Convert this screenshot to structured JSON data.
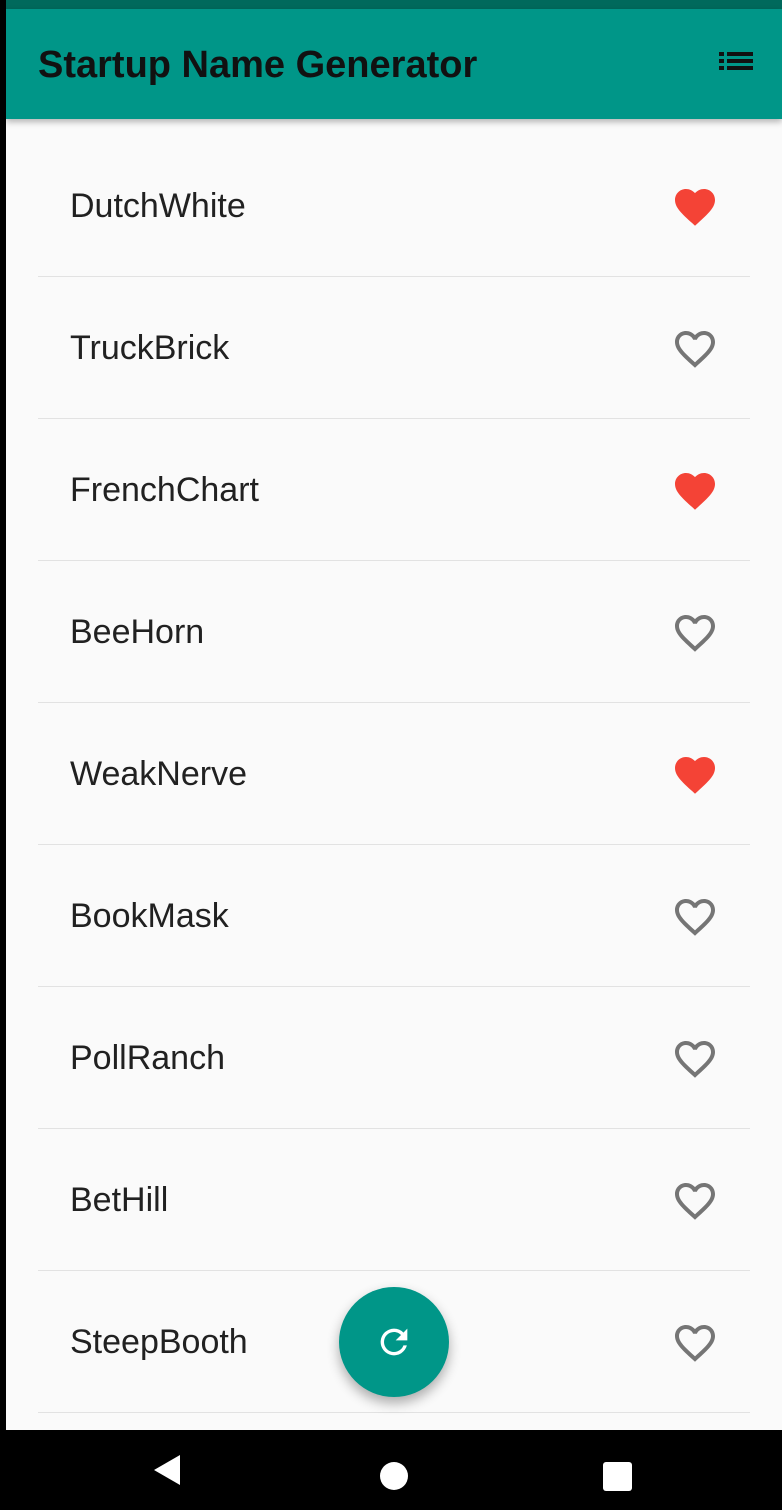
{
  "app_bar": {
    "title": "Startup Name Generator",
    "list_icon": "list-icon"
  },
  "rows": [
    {
      "label": "DutchWhite",
      "favorite": true
    },
    {
      "label": "TruckBrick",
      "favorite": false
    },
    {
      "label": "FrenchChart",
      "favorite": true
    },
    {
      "label": "BeeHorn",
      "favorite": false
    },
    {
      "label": "WeakNerve",
      "favorite": true
    },
    {
      "label": "BookMask",
      "favorite": false
    },
    {
      "label": "PollRanch",
      "favorite": false
    },
    {
      "label": "BetHill",
      "favorite": false
    },
    {
      "label": "SteepBooth",
      "favorite": false
    }
  ],
  "fab": {
    "icon": "refresh-icon"
  },
  "nav_bar": {
    "back_icon": "back-icon",
    "home_icon": "home-icon",
    "recents_icon": "recents-icon"
  },
  "colors": {
    "primary": "#009688",
    "primary_dark": "#00695c",
    "favorite": "#f44336",
    "unfavorite": "#757575",
    "background": "#fafafa",
    "divider": "#e2e2e2"
  }
}
